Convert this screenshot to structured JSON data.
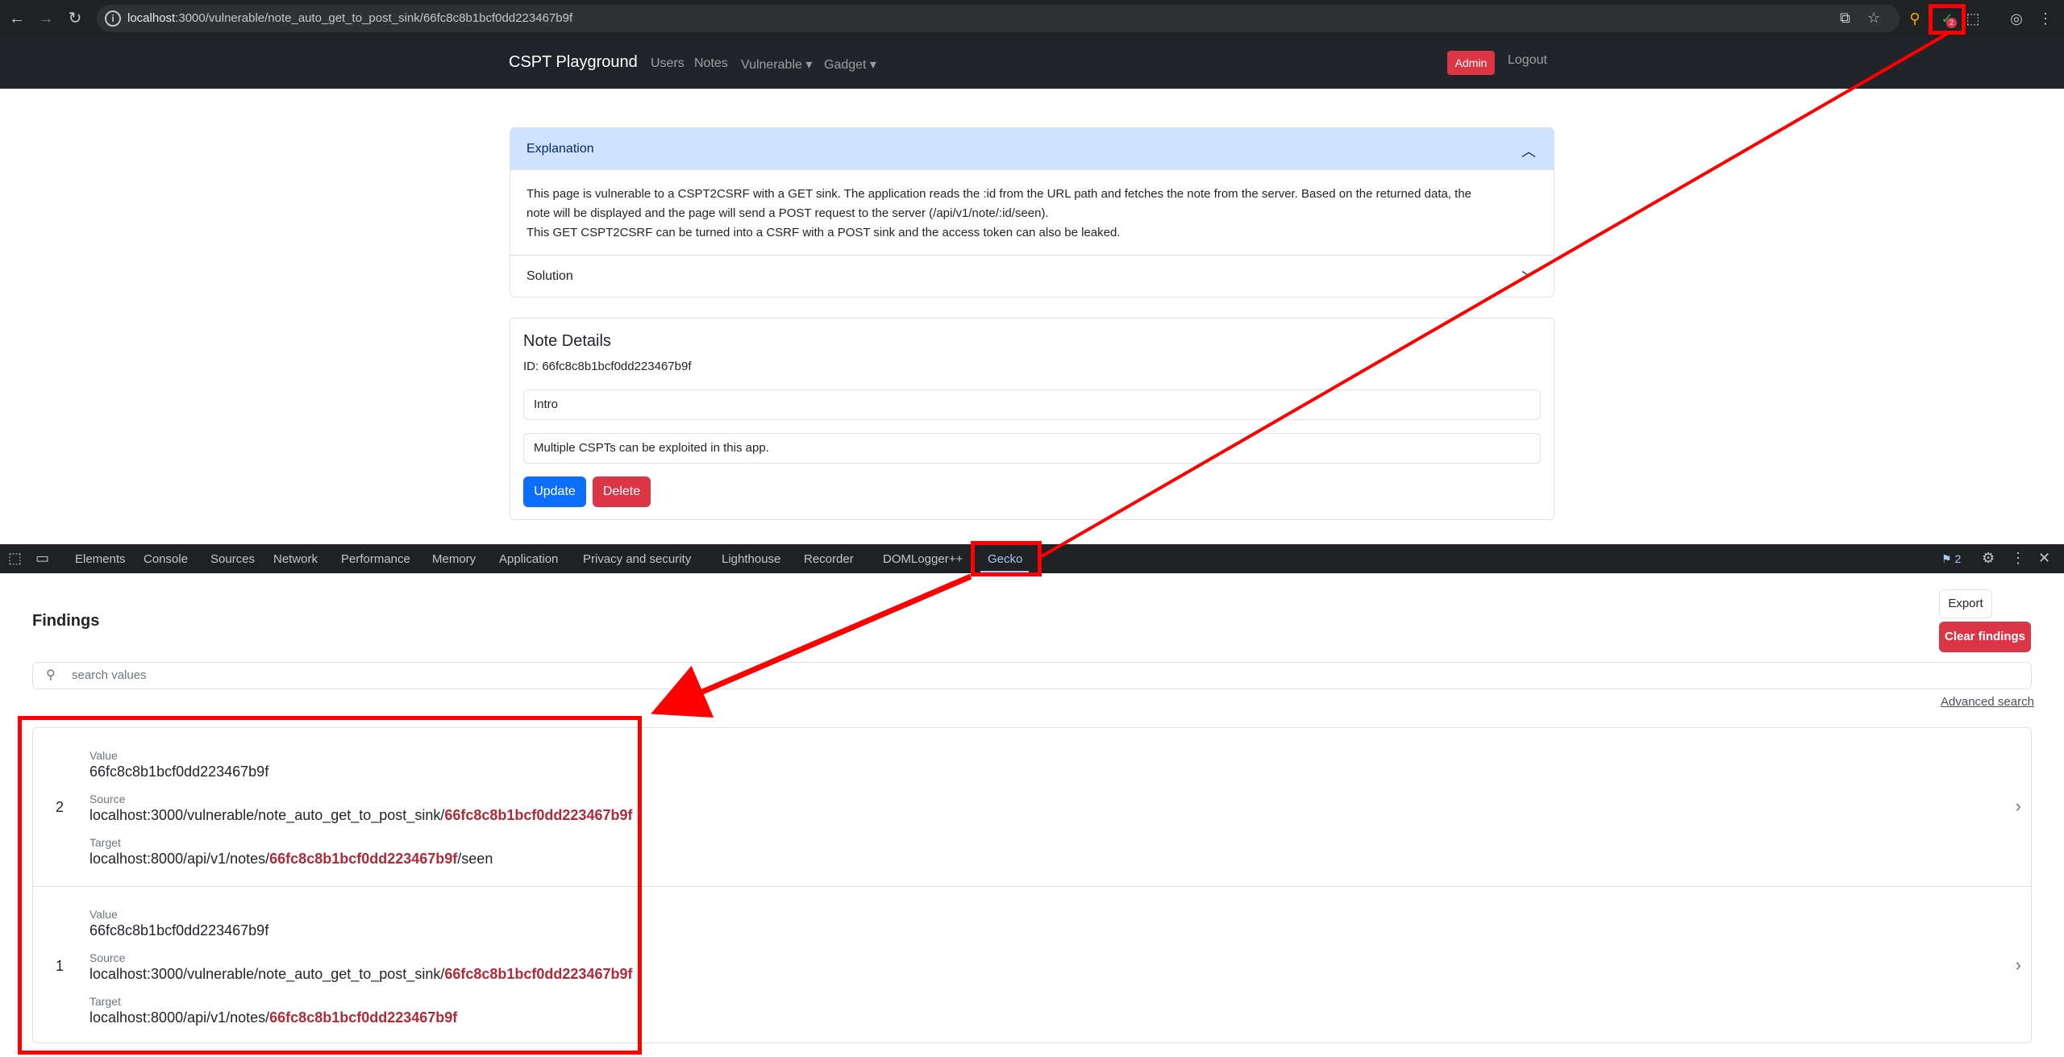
{
  "browser": {
    "url_host": "localhost",
    "url_path": ":3000/vulnerable/note_auto_get_to_post_sink/66fc8c8b1bcf0dd223467b9f",
    "extension_badge": "2"
  },
  "navbar": {
    "brand": "CSPT Playground",
    "links": [
      "Users",
      "Notes",
      "Vulnerable ▾",
      "Gadget ▾"
    ],
    "admin_badge": "Admin",
    "logout": "Logout"
  },
  "explanation": {
    "title": "Explanation",
    "line1": "This page is vulnerable to a CSPT2CSRF with a GET sink. The application reads the :id from the URL path and fetches the note from the server. Based on the returned data, the",
    "line2": "note will be displayed and the page will send a POST request to the server (/api/v1/note/:id/seen).",
    "line3": "This GET CSPT2CSRF can be turned into a CSRF with a POST sink and the access token can also be leaked.",
    "solution_title": "Solution"
  },
  "note": {
    "title": "Note Details",
    "id_line": "ID: 66fc8c8b1bcf0dd223467b9f",
    "title_value": "Intro",
    "content_value": "Multiple CSPTs can be exploited in this app.",
    "update_label": "Update",
    "delete_label": "Delete"
  },
  "devtools": {
    "tabs": [
      "Elements",
      "Console",
      "Sources",
      "Network",
      "Performance",
      "Memory",
      "Application",
      "Privacy and security",
      "Lighthouse",
      "Recorder",
      "DOMLogger++",
      "Gecko"
    ],
    "issues_count": "2"
  },
  "gecko": {
    "title": "Findings",
    "export_label": "Export",
    "clear_label": "Clear findings",
    "search_placeholder": "search values",
    "advanced_search": "Advanced search",
    "value_label": "Value",
    "source_label": "Source",
    "target_label": "Target",
    "findings": [
      {
        "num": "2",
        "value": "66fc8c8b1bcf0dd223467b9f",
        "source_prefix": "localhost:3000/vulnerable/note_auto_get_to_post_sink/",
        "source_hl": "66fc8c8b1bcf0dd223467b9f",
        "target_prefix": "localhost:8000/api/v1/notes/",
        "target_hl": "66fc8c8b1bcf0dd223467b9f",
        "target_suffix": "/seen"
      },
      {
        "num": "1",
        "value": "66fc8c8b1bcf0dd223467b9f",
        "source_prefix": "localhost:3000/vulnerable/note_auto_get_to_post_sink/",
        "source_hl": "66fc8c8b1bcf0dd223467b9f",
        "target_prefix": "localhost:8000/api/v1/notes/",
        "target_hl": "66fc8c8b1bcf0dd223467b9f",
        "target_suffix": ""
      }
    ]
  },
  "colors": {
    "annotation": "#ff0000",
    "danger": "#dc3545",
    "primary": "#0d6efd",
    "highlight": "#b02a37"
  }
}
